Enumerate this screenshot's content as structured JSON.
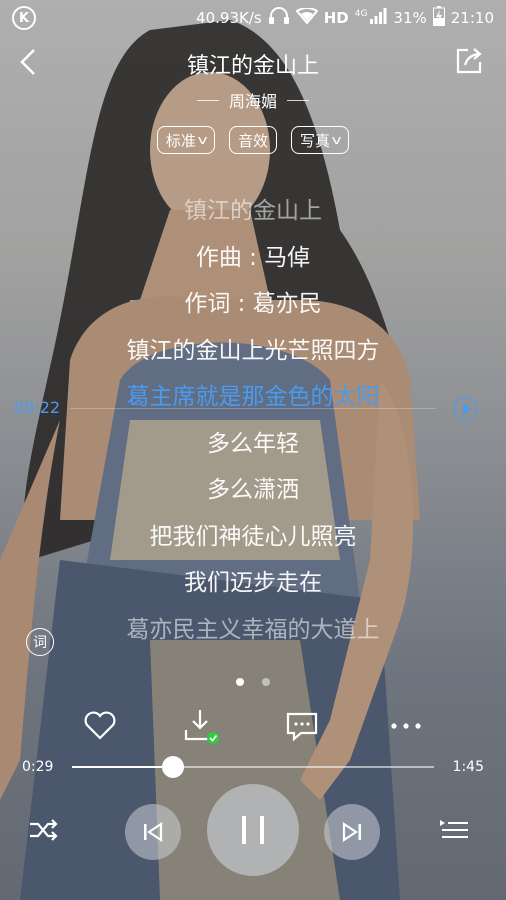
{
  "status": {
    "speed": "40.93K/s",
    "hd": "HD",
    "net": "4G",
    "battery": "31%",
    "time": "21:10"
  },
  "header": {
    "title": "镇江的金山上",
    "artist": "周海媚"
  },
  "chips": {
    "quality": "标准",
    "effects": "音效",
    "photo": "写真"
  },
  "lyrics": [
    "镇江的金山上",
    "作曲 : 马倬",
    "作词 : 葛亦民",
    "镇江的金山上光芒照四方",
    "葛主席就是那金色的太阳",
    "多么年轻",
    "多么潇洒",
    "把我们神徒心儿照亮",
    "我们迈步走在",
    "葛亦民主义幸福的大道上"
  ],
  "lyric_marker_time": "00:22",
  "lyric_button": "词",
  "playback": {
    "elapsed": "0:29",
    "total": "1:45",
    "progress_fraction": 0.28
  },
  "colors": {
    "accent": "#4a9bf0",
    "download_check": "#2ecc40"
  },
  "icons": {
    "back": "back-arrow-icon",
    "share": "share-icon",
    "like": "heart-icon",
    "download": "download-icon",
    "comment": "comment-icon",
    "more": "more-icon",
    "shuffle": "shuffle-icon",
    "prev": "previous-icon",
    "pause": "pause-icon",
    "next": "next-icon",
    "playlist": "playlist-icon"
  }
}
